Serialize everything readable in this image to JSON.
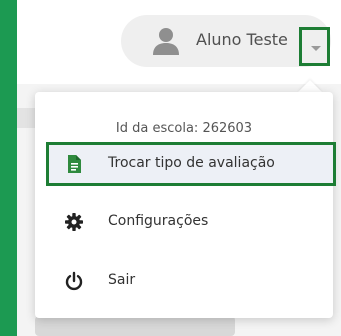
{
  "header": {
    "user_name": "Aluno Teste",
    "avatar_icon": "user-avatar-icon",
    "caret_icon": "caret-down-icon"
  },
  "dropdown": {
    "school_id_label": "Id da escola: 262603",
    "items": [
      {
        "label": "Trocar tipo de avaliação",
        "icon": "document-icon",
        "highlighted": true
      },
      {
        "label": "Configurações",
        "icon": "gear-icon"
      },
      {
        "label": "Sair",
        "icon": "power-icon"
      }
    ]
  },
  "colors": {
    "frame_green": "#1c9a52",
    "highlight_border": "#1d7d34",
    "document_icon": "#2f8a3e"
  }
}
